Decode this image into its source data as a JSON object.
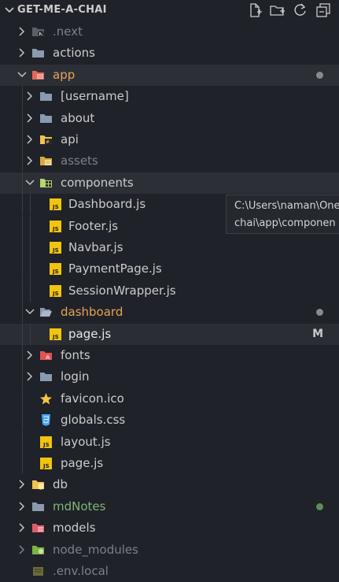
{
  "explorer": {
    "title": "GET-ME-A-CHAI",
    "actions": [
      "new-file-icon",
      "new-folder-icon",
      "refresh-icon",
      "collapse-all-icon"
    ]
  },
  "tree": [
    {
      "label": ".next",
      "icon": "next-folder-icon",
      "expanded": false,
      "dim": true
    },
    {
      "label": "actions",
      "icon": "folder-icon",
      "expanded": false
    },
    {
      "label": "app",
      "icon": "app-folder-icon",
      "expanded": true,
      "color": "orange",
      "dot": "#8a8a8a"
    },
    {
      "label": "[username]",
      "icon": "folder-icon",
      "expanded": false
    },
    {
      "label": "about",
      "icon": "folder-icon",
      "expanded": false
    },
    {
      "label": "api",
      "icon": "api-folder-icon",
      "expanded": false
    },
    {
      "label": "assets",
      "icon": "assets-folder-icon",
      "expanded": false,
      "dim": true
    },
    {
      "label": "components",
      "icon": "components-folder-icon",
      "expanded": true
    },
    {
      "label": "Dashboard.js",
      "icon": "js-file-icon"
    },
    {
      "label": "Footer.js",
      "icon": "js-file-icon"
    },
    {
      "label": "Navbar.js",
      "icon": "js-file-icon"
    },
    {
      "label": "PaymentPage.js",
      "icon": "js-file-icon"
    },
    {
      "label": "SessionWrapper.js",
      "icon": "js-file-icon"
    },
    {
      "label": "dashboard",
      "icon": "open-folder-icon",
      "expanded": true,
      "color": "orange",
      "dot": "#8a8a8a"
    },
    {
      "label": "page.js",
      "icon": "js-file-icon",
      "status": "M"
    },
    {
      "label": "fonts",
      "icon": "fonts-folder-icon",
      "expanded": false
    },
    {
      "label": "login",
      "icon": "folder-icon",
      "expanded": false
    },
    {
      "label": "favicon.ico",
      "icon": "star-icon"
    },
    {
      "label": "globals.css",
      "icon": "css-file-icon"
    },
    {
      "label": "layout.js",
      "icon": "js-file-icon"
    },
    {
      "label": "page.js",
      "icon": "js-file-icon"
    },
    {
      "label": "db",
      "icon": "db-folder-icon",
      "expanded": false
    },
    {
      "label": "mdNotes",
      "icon": "folder-icon",
      "expanded": false,
      "color": "green",
      "dot": "#5f8d59"
    },
    {
      "label": "models",
      "icon": "models-folder-icon",
      "expanded": false
    },
    {
      "label": "node_modules",
      "icon": "node-folder-icon",
      "expanded": false,
      "dim": true
    },
    {
      "label": ".env.local",
      "icon": "env-file-icon",
      "dim": true
    }
  ],
  "tooltip": {
    "line1": "C:\\Users\\naman\\One",
    "line2": "chai\\app\\componen"
  },
  "colors": {
    "background": "#1f2228",
    "folder": "#8a9bb0",
    "js": "#f1c40f",
    "orange_text": "#e5a35a",
    "green_text": "#7fb57a"
  }
}
